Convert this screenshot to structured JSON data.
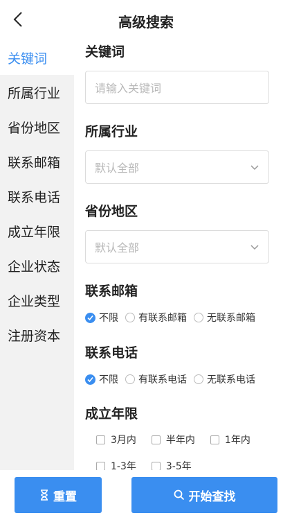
{
  "header": {
    "title": "高级搜索"
  },
  "sidebar": {
    "items": [
      {
        "label": "关键词"
      },
      {
        "label": "所属行业"
      },
      {
        "label": "省份地区"
      },
      {
        "label": "联系邮箱"
      },
      {
        "label": "联系电话"
      },
      {
        "label": "成立年限"
      },
      {
        "label": "企业状态"
      },
      {
        "label": "企业类型"
      },
      {
        "label": "注册资本"
      }
    ],
    "active_index": 0
  },
  "form": {
    "keyword": {
      "title": "关键词",
      "placeholder": "请输入关键词"
    },
    "industry": {
      "title": "所属行业",
      "value": "默认全部"
    },
    "region": {
      "title": "省份地区",
      "value": "默认全部"
    },
    "email": {
      "title": "联系邮箱",
      "options": [
        "不限",
        "有联系邮箱",
        "无联系邮箱"
      ],
      "selected": "不限"
    },
    "phone": {
      "title": "联系电话",
      "options": [
        "不限",
        "有联系电话",
        "无联系电话"
      ],
      "selected": "不限"
    },
    "years": {
      "title": "成立年限",
      "options": [
        "3月内",
        "半年内",
        "1年内",
        "1-3年",
        "3-5年"
      ]
    }
  },
  "footer": {
    "reset_label": "重置",
    "search_label": "开始查找"
  },
  "colors": {
    "accent": "#3a8ef0",
    "sidebar_bg": "#f2f2f2"
  }
}
